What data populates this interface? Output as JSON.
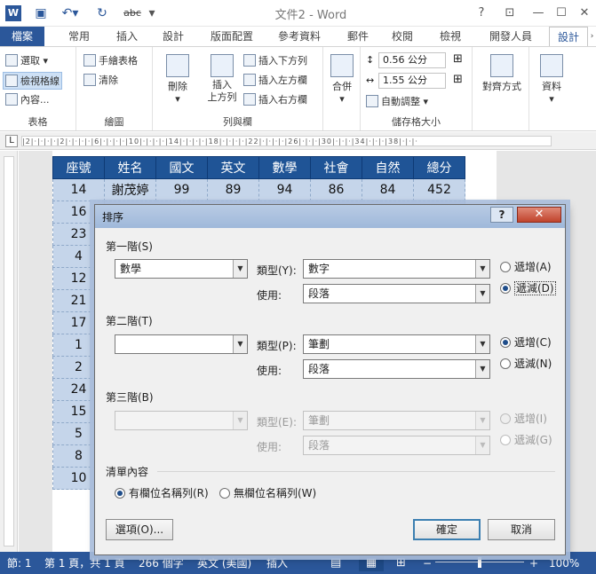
{
  "titlebar": {
    "app_logo": "W",
    "title": "文件2 - Word",
    "help": "?",
    "icons": [
      "save-icon",
      "undo-icon",
      "redo-icon",
      "abc-icon",
      "customize-icon"
    ],
    "abc_label": "abc"
  },
  "tabs": [
    "檔案",
    "常用",
    "插入",
    "設計",
    "版面配置",
    "參考資料",
    "郵件",
    "校閱",
    "檢視",
    "開發人員",
    "設計"
  ],
  "ribbon": {
    "table_group": {
      "label": "表格",
      "select": "選取",
      "view_gridlines": "檢視格線",
      "properties": "內容..."
    },
    "draw_group": {
      "label": "繪圖",
      "draw_table": "手繪表格",
      "eraser": "清除"
    },
    "rows_cols_group": {
      "label": "列與欄",
      "delete": "刪除",
      "insert_above_1": "插入",
      "insert_above_2": "上方列",
      "insert_below": "插入下方列",
      "insert_left": "插入左方欄",
      "insert_right": "插入右方欄"
    },
    "merge_group": {
      "merge": "合併"
    },
    "cell_size_group": {
      "label": "儲存格大小",
      "height": "0.56 公分",
      "width": "1.55 公分",
      "autofit": "自動調整"
    },
    "align_group": {
      "align": "對齊方式"
    },
    "data_group": {
      "data": "資料"
    }
  },
  "table": {
    "headers": [
      "座號",
      "姓名",
      "國文",
      "英文",
      "數學",
      "社會",
      "自然",
      "總分"
    ],
    "first_row": [
      "14",
      "謝茂婷",
      "99",
      "89",
      "94",
      "86",
      "84",
      "452"
    ],
    "seat_numbers": [
      "16",
      "23",
      "4",
      "12",
      "21",
      "17",
      "1",
      "2",
      "24",
      "15",
      "5",
      "8",
      "10"
    ]
  },
  "dialog": {
    "title": "排序",
    "help": "?",
    "close": "✕",
    "level1": {
      "label": "第一階(S)",
      "field": "數學",
      "type_label": "類型(Y):",
      "type": "數字",
      "use_label": "使用:",
      "use": "段落",
      "asc": "遞增(A)",
      "desc": "遞減(D)"
    },
    "level2": {
      "label": "第二階(T)",
      "field": "",
      "type_label": "類型(P):",
      "type": "筆劃",
      "use_label": "使用:",
      "use": "段落",
      "asc": "遞增(C)",
      "desc": "遞減(N)"
    },
    "level3": {
      "label": "第三階(B)",
      "field": "",
      "type_label": "類型(E):",
      "type": "筆劃",
      "use_label": "使用:",
      "use": "段落",
      "asc": "遞增(I)",
      "desc": "遞減(G)"
    },
    "list_group": {
      "label": "清單內容",
      "with_header": "有欄位名稱列(R)",
      "no_header": "無欄位名稱列(W)"
    },
    "options": "選項(O)...",
    "ok": "確定",
    "cancel": "取消"
  },
  "status": {
    "section": "節: 1",
    "page": "第 1 頁，共 1 頁",
    "words": "266 個字",
    "language": "英文 (美國)",
    "mode": "插入",
    "zoom": "100%"
  },
  "colors": {
    "accent": "#2b579a",
    "table_header": "#1f5496",
    "table_body": "#c5d5ea"
  }
}
